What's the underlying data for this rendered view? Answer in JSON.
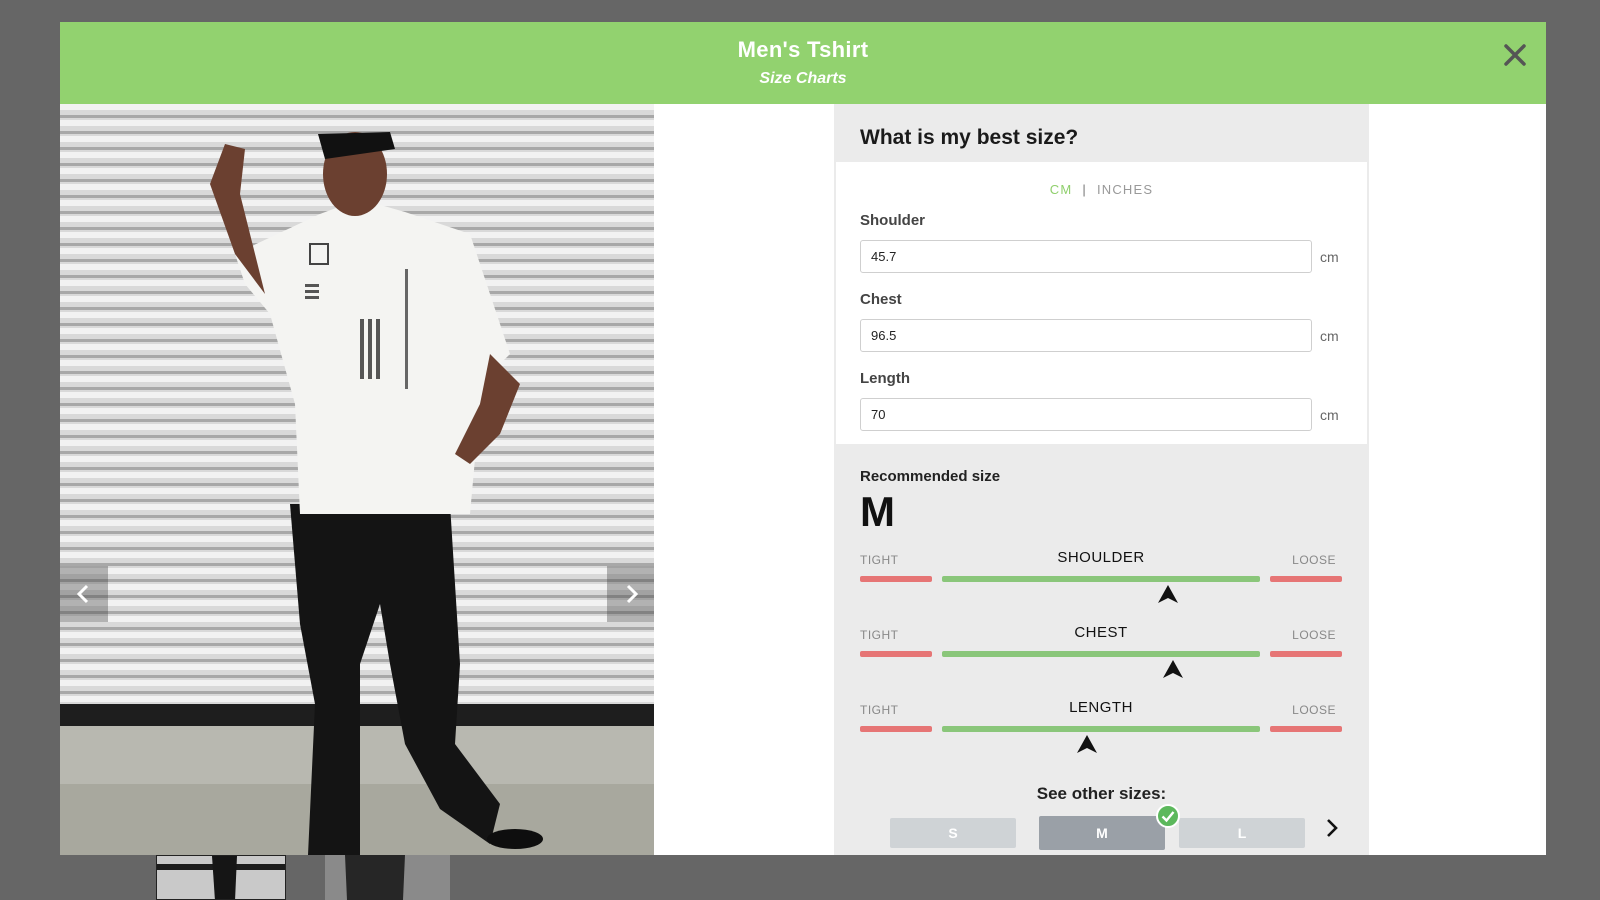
{
  "modal": {
    "title": "Men's Tshirt",
    "subtitle": "Size Charts",
    "header_color": "#92d26f"
  },
  "size_panel": {
    "heading": "What is my best size?",
    "units": {
      "cm": "CM",
      "separator": "|",
      "inches": "INCHES",
      "selected": "CM"
    },
    "fields": [
      {
        "label": "Shoulder",
        "value": "45.7",
        "unit": "cm"
      },
      {
        "label": "Chest",
        "value": "96.5",
        "unit": "cm"
      },
      {
        "label": "Length",
        "value": "70",
        "unit": "cm"
      }
    ],
    "recommended_label": "Recommended size",
    "recommended_size": "M",
    "fit_scales": [
      {
        "name": "SHOULDER",
        "tight": "TIGHT",
        "loose": "LOOSE",
        "position": 0.64
      },
      {
        "name": "CHEST",
        "tight": "TIGHT",
        "loose": "LOOSE",
        "position": 0.65
      },
      {
        "name": "LENGTH",
        "tight": "TIGHT",
        "loose": "LOOSE",
        "position": 0.47
      }
    ],
    "see_other_label": "See other sizes:",
    "sizes": [
      {
        "label": "S",
        "selected": false
      },
      {
        "label": "M",
        "selected": true
      },
      {
        "label": "L",
        "selected": false
      }
    ]
  },
  "colors": {
    "accent_green": "#92d26f",
    "fit_green": "#8ac67a",
    "fit_red": "#e67575",
    "check_green": "#5cb85c"
  }
}
